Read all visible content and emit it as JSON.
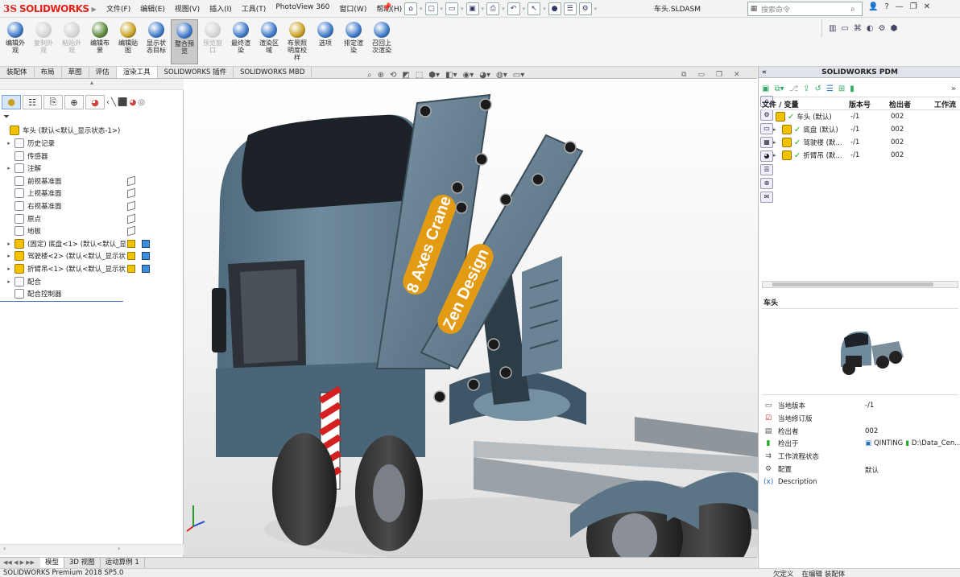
{
  "app": {
    "logo": "SOLIDWORKS",
    "doc_title": "车头.SLDASM",
    "search_placeholder": "搜索命令"
  },
  "menu": [
    "文件(F)",
    "编辑(E)",
    "视图(V)",
    "插入(I)",
    "工具(T)",
    "PhotoView 360",
    "窗口(W)",
    "帮助(H)"
  ],
  "command_buttons": [
    {
      "label": "编辑外\n观",
      "state": "normal",
      "color": "#3c78c8"
    },
    {
      "label": "复制外\n观",
      "state": "disabled",
      "color": "#999999"
    },
    {
      "label": "粘贴外\n观",
      "state": "disabled",
      "color": "#999999"
    },
    {
      "label": "编辑布\n景",
      "state": "normal",
      "color": "#5a8a3a"
    },
    {
      "label": "编辑贴\n图",
      "state": "normal",
      "color": "#c8a020"
    },
    {
      "label": "显示状\n态目标",
      "state": "normal",
      "color": "#3c78c8"
    },
    {
      "label": "整合预\n览",
      "state": "active",
      "color": "#3c78c8"
    },
    {
      "label": "预览窗\n口",
      "state": "disabled",
      "color": "#999999"
    },
    {
      "label": "最终渲\n染",
      "state": "normal",
      "color": "#3c78c8"
    },
    {
      "label": "渲染区\n域",
      "state": "normal",
      "color": "#3c78c8"
    },
    {
      "label": "布景照\n明度校\n样",
      "state": "normal",
      "color": "#c8a020"
    },
    {
      "label": "选项",
      "state": "normal",
      "color": "#3c78c8"
    },
    {
      "label": "排定渲\n染",
      "state": "normal",
      "color": "#3c78c8"
    },
    {
      "label": "召回上\n次渲染",
      "state": "normal",
      "color": "#3c78c8"
    }
  ],
  "tabs": [
    {
      "label": "装配体",
      "active": false
    },
    {
      "label": "布局",
      "active": false
    },
    {
      "label": "草图",
      "active": false
    },
    {
      "label": "评估",
      "active": false
    },
    {
      "label": "渲染工具",
      "active": true
    },
    {
      "label": "SOLIDWORKS 插件",
      "active": false
    },
    {
      "label": "SOLIDWORKS MBD",
      "active": false
    }
  ],
  "tree": {
    "root": "车头 (默认<默认_显示状态-1>)",
    "items": [
      {
        "label": "历史记录",
        "expand": true
      },
      {
        "label": "传感器",
        "expand": false
      },
      {
        "label": "注解",
        "expand": true
      },
      {
        "label": "前视基准面",
        "expand": false
      },
      {
        "label": "上视基准面",
        "expand": false
      },
      {
        "label": "右视基准面",
        "expand": false
      },
      {
        "label": "原点",
        "expand": false
      },
      {
        "label": "地板",
        "expand": false
      },
      {
        "label": "(固定) 底盘<1> (默认<默认_显",
        "expand": true
      },
      {
        "label": "驾驶楼<2> (默认<默认_显示状",
        "expand": true
      },
      {
        "label": "折臂吊<1> (默认<默认_显示状",
        "expand": true
      },
      {
        "label": "配合",
        "expand": true
      },
      {
        "label": "配合控制器",
        "expand": false
      }
    ]
  },
  "bottom_tabs": [
    {
      "label": "模型",
      "active": true
    },
    {
      "label": "3D 视图",
      "active": false
    },
    {
      "label": "运动算例 1",
      "active": false
    }
  ],
  "status": {
    "left": "SOLIDWORKS Premium 2018 SP5.0",
    "right": [
      "欠定义",
      "在编辑 装配体"
    ]
  },
  "viewport": {
    "crane_text_1": "8 Axes Crane",
    "crane_text_2": "Zen Design"
  },
  "pdm": {
    "title": "SOLIDWORKS PDM",
    "columns": [
      "文件 / 变量",
      "版本号",
      "检出者",
      "工作流"
    ],
    "rows": [
      {
        "name": "车头 (默认)",
        "ver": "-/1",
        "by": "002"
      },
      {
        "name": "底盘 (默认)",
        "ver": "-/1",
        "by": "002"
      },
      {
        "name": "驾驶楼 (默...",
        "ver": "-/1",
        "by": "002"
      },
      {
        "name": "折臂吊 (默...",
        "ver": "-/1",
        "by": "002"
      }
    ],
    "preview_title": "车头",
    "props": [
      {
        "label": "当地版本",
        "value": "-/1",
        "icon": "doc"
      },
      {
        "label": "当地修订版",
        "value": "",
        "icon": "check"
      },
      {
        "label": "检出者",
        "value": "002",
        "icon": "page"
      },
      {
        "label": "检出于",
        "value": "QINTING",
        "value2": "D:\\Data_Cen...",
        "icon": "green"
      },
      {
        "label": "工作流程状态",
        "value": "",
        "icon": "flow"
      },
      {
        "label": "配置",
        "value": "默认",
        "icon": "cfg"
      },
      {
        "label": "Description",
        "value": "",
        "icon": "x"
      }
    ]
  }
}
